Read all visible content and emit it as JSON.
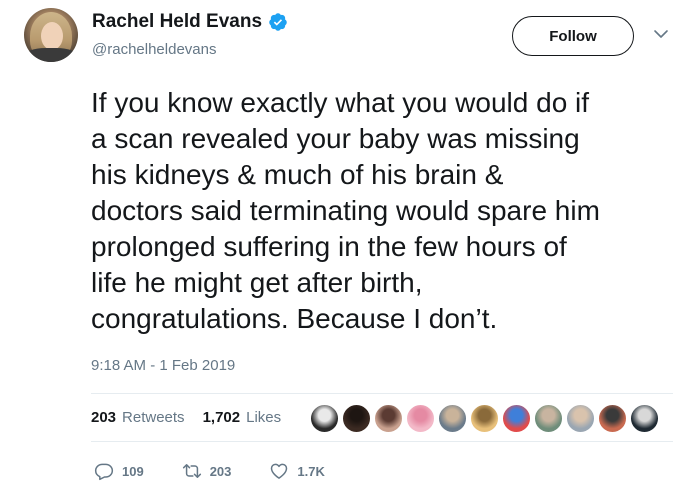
{
  "author": {
    "display_name": "Rachel Held Evans",
    "handle": "@rachelheldevans",
    "verified_icon": "verified-badge-icon",
    "verified_color": "#1da1f2"
  },
  "header": {
    "follow_label": "Follow",
    "more_icon": "chevron-down-icon"
  },
  "tweet": {
    "lines": [
      "If you know exactly what you would do if",
      "a scan revealed your baby was missing",
      "his kidneys & much of his brain &",
      "doctors said terminating would spare him",
      "prolonged suffering in the few hours of",
      "life he might get after birth,",
      "congratulations. Because I don’t."
    ],
    "timestamp": "9:18 AM - 1 Feb 2019"
  },
  "stats": {
    "retweets_count": "203",
    "retweets_label": "Retweets",
    "likes_count": "1,702",
    "likes_label": "Likes",
    "liker_avatars": [
      {
        "name": "liker-avatar-1",
        "colors": [
          "#2a2a2a",
          "#e9e9e9"
        ]
      },
      {
        "name": "liker-avatar-2",
        "colors": [
          "#3b2a22",
          "#1e1612"
        ]
      },
      {
        "name": "liker-avatar-3",
        "colors": [
          "#c9a18f",
          "#5b3b33"
        ]
      },
      {
        "name": "liker-avatar-4",
        "colors": [
          "#f3b9c8",
          "#e58aa3"
        ]
      },
      {
        "name": "liker-avatar-5",
        "colors": [
          "#6b7b8a",
          "#c9b39a"
        ]
      },
      {
        "name": "liker-avatar-6",
        "colors": [
          "#e8c07a",
          "#8a6a3a"
        ]
      },
      {
        "name": "liker-avatar-7",
        "colors": [
          "#e14b4b",
          "#3f7fd9"
        ]
      },
      {
        "name": "liker-avatar-8",
        "colors": [
          "#6f8d7a",
          "#c8b4a0"
        ]
      },
      {
        "name": "liker-avatar-9",
        "colors": [
          "#9aa6b2",
          "#d9c3ad"
        ]
      },
      {
        "name": "liker-avatar-10",
        "colors": [
          "#c96a50",
          "#3a3a3a"
        ]
      },
      {
        "name": "liker-avatar-11",
        "colors": [
          "#1f2a33",
          "#d8d8d8"
        ]
      }
    ]
  },
  "actions": {
    "reply_icon": "reply-icon",
    "reply_count": "109",
    "retweet_icon": "retweet-icon",
    "retweet_count": "203",
    "like_icon": "heart-icon",
    "like_count": "1.7K",
    "icon_color": "#657786"
  }
}
